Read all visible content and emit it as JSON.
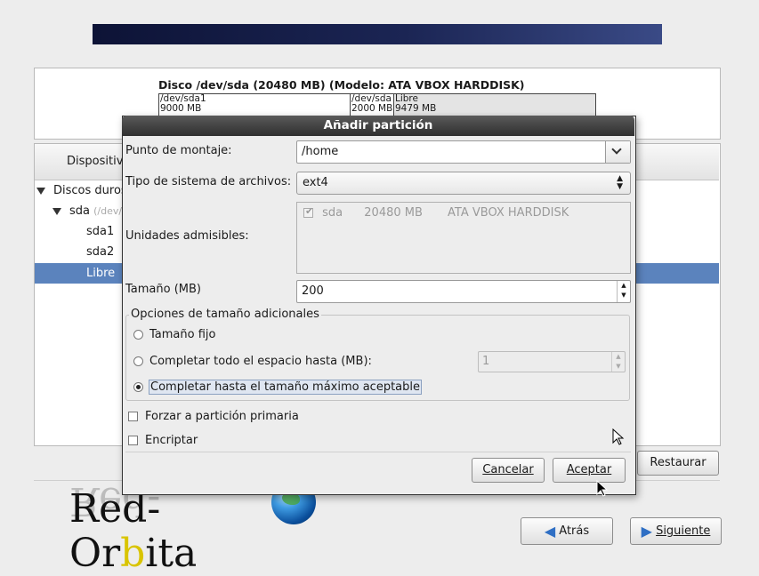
{
  "installer": {
    "disk_title": "Disco /dev/sda (20480 MB) (Modelo: ATA VBOX HARDDISK)",
    "segments": [
      {
        "name": "/dev/sda1",
        "size": "9000 MB"
      },
      {
        "name": "/dev/sda",
        "size": "2000 MB"
      },
      {
        "name": "Libre",
        "size": "9479 MB"
      }
    ],
    "tree_header": "Dispositivo",
    "tree": {
      "root": "Discos duros",
      "disk": "sda",
      "disk_path": "(/dev/",
      "parts": [
        "sda1",
        "sda2"
      ],
      "selected": "Libre"
    },
    "restore_button": "Restaurar",
    "back_button": "Atrás",
    "next_button": "Siguiente"
  },
  "logo": {
    "pre": "Red-Or",
    "highlight": "b",
    "post": "ita"
  },
  "dialog": {
    "title": "Añadir partición",
    "mount_label": "Punto de montaje:",
    "mount_value": "/home",
    "fstype_label": "Tipo de sistema de archivos:",
    "fstype_value": "ext4",
    "drives_label": "Unidades admisibles:",
    "drive": {
      "name": "sda",
      "size": "20480 MB",
      "model": "ATA VBOX HARDDISK",
      "checked": true
    },
    "size_label": "Tamaño (MB)",
    "size_value": "200",
    "options_title": "Opciones de tamaño adicionales",
    "opt_fixed": "Tamaño fijo",
    "opt_fill_upto": "Completar todo el espacio hasta (MB):",
    "opt_fill_upto_value": "1",
    "opt_fill_max": "Completar hasta el tamaño máximo aceptable",
    "force_primary": "Forzar a partición primaria",
    "encrypt": "Encriptar",
    "cancel": "Cancelar",
    "accept": "Aceptar"
  }
}
